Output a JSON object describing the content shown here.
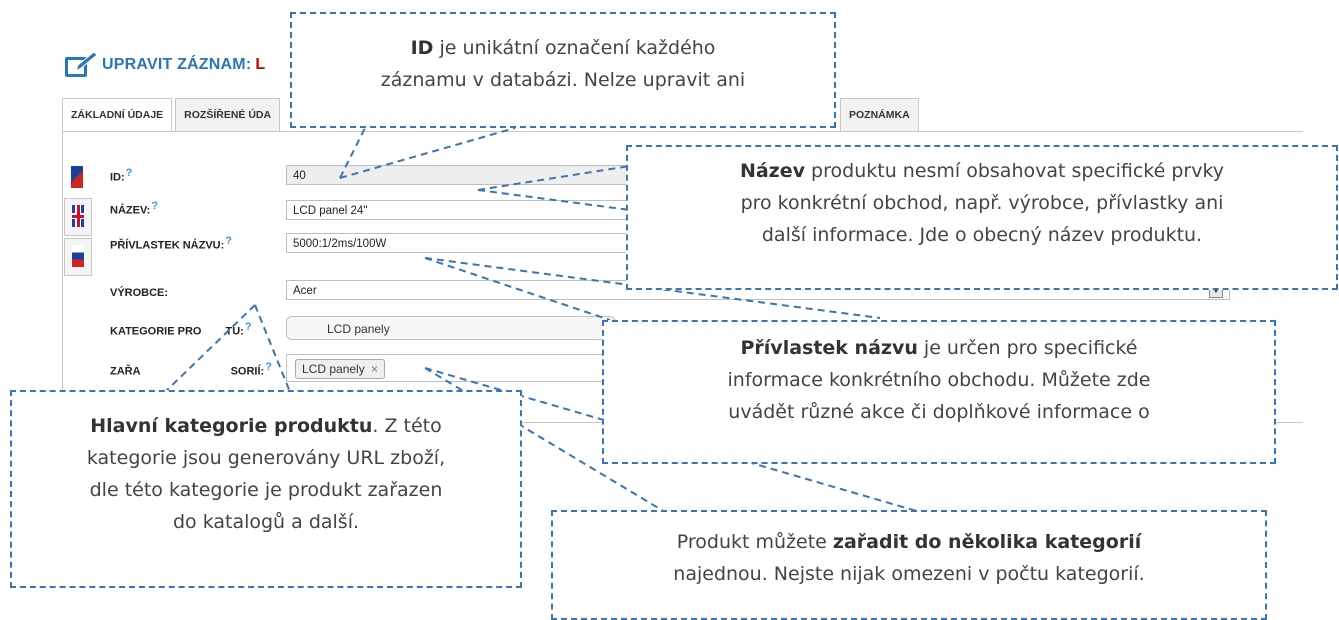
{
  "header": {
    "title": "UPRAVIT ZÁZNAM:",
    "record_marker": "L"
  },
  "tabs": [
    {
      "label": "ZÁKLADNÍ ÚDAJE",
      "active": true
    },
    {
      "label": "ROZŠÍŘENÉ ÚDA"
    },
    {
      "label": "POZNÁMKA"
    }
  ],
  "help_mark": "?",
  "form": {
    "id": {
      "label": "ID:",
      "value": "40"
    },
    "name": {
      "label": "NÁZEV:",
      "value": "LCD panel 24\""
    },
    "suffix": {
      "label": "PŘÍVLASTEK NÁZVU:",
      "value": "5000:1/2ms/100W"
    },
    "manufacturer": {
      "label": "VÝROBCE:",
      "value": "Acer",
      "dropdown_icon": "chevron-down-icon"
    },
    "category": {
      "label_part1": "KATEGORIE PRO",
      "label_part2": "TU:",
      "value": "LCD panely"
    },
    "assign": {
      "label_part1": "ZAŘA",
      "label_part2": "SORIÍ:",
      "chip": "LCD panely",
      "chip_remove": "×"
    }
  },
  "callouts": {
    "id": {
      "bold": "ID",
      "line1_rest": " je unikátní označení každého",
      "line2": "záznamu v databázi. Nelze upravit ani"
    },
    "name": {
      "bold": "Název",
      "line1_rest": " produktu nesmí obsahovat specifické prvky",
      "line2": "pro konkrétní obchod, např. výrobce, přívlastky ani",
      "line3": "další informace. Jde o obecný název produktu."
    },
    "suffix": {
      "bold": "Přívlastek názvu",
      "line1_rest": " je určen pro specifické",
      "line2": "informace konkrétního obchodu. Můžete zde",
      "line3": "uvádět různé akce či doplňkové informace o"
    },
    "category": {
      "bold": "Hlavní kategorie produktu",
      "line1_rest": ". Z této",
      "line2": "kategorie jsou generovány URL zboží,",
      "line3": "dle této kategorie je produkt zařazen",
      "line4": "do katalogů a další."
    },
    "assign": {
      "line1_pre": "Produkt můžete ",
      "bold": "zařadit do několika kategorií",
      "line2": "najednou. Nejste nijak omezeni v počtu kategorií."
    }
  },
  "colors": {
    "accent": "#2a76b8",
    "record": "#c40000",
    "callout_border": "#3a74b6"
  }
}
